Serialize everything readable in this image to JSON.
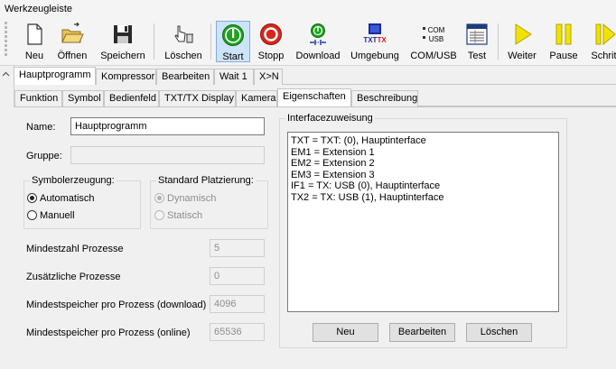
{
  "window": {
    "title": "Werkzeugleiste"
  },
  "toolbar": {
    "buttons": [
      {
        "label": "Neu",
        "icon": "new-document-icon"
      },
      {
        "label": "Öffnen",
        "icon": "open-folder-icon"
      },
      {
        "label": "Speichern",
        "icon": "floppy-disk-icon"
      },
      {
        "label": "Löschen",
        "icon": "delete-pointer-icon"
      },
      {
        "label": "Start",
        "icon": "start-icon"
      },
      {
        "label": "Stopp",
        "icon": "stop-icon"
      },
      {
        "label": "Download",
        "icon": "download-icon"
      },
      {
        "label": "Umgebung",
        "icon": "environment-icon",
        "icon_text": "TXTTX"
      },
      {
        "label": "COM/USB",
        "icon": "com-usb-icon",
        "icon_text": [
          "COM",
          "USB"
        ]
      },
      {
        "label": "Test",
        "icon": "test-window-icon"
      },
      {
        "label": "Weiter",
        "icon": "play-icon"
      },
      {
        "label": "Pause",
        "icon": "pause-icon"
      },
      {
        "label": "Schritt",
        "icon": "step-icon"
      }
    ],
    "active": "Start"
  },
  "program_tabs": [
    "Hauptprogramm",
    "Kompressor",
    "Bearbeiten",
    "Wait 1",
    "X>N"
  ],
  "program_tabs_selected": "Hauptprogramm",
  "sub_tabs": [
    "Funktion",
    "Symbol",
    "Bedienfeld",
    "TXT/TX Display",
    "Kamera",
    "Eigenschaften",
    "Beschreibung"
  ],
  "sub_tabs_selected": "Eigenschaften",
  "properties": {
    "name_label": "Name:",
    "name_value": "Hauptprogramm",
    "gruppe_label": "Gruppe:",
    "gruppe_value": "",
    "symbol_group": {
      "title": "Symbolerzeugung:",
      "options": [
        "Automatisch",
        "Manuell"
      ],
      "selected": "Automatisch"
    },
    "placement_group": {
      "title": "Standard Platzierung:",
      "options": [
        "Dynamisch",
        "Statisch"
      ],
      "selected": "Dynamisch",
      "disabled": true
    },
    "fields": [
      {
        "label": "Mindestzahl Prozesse",
        "value": "5"
      },
      {
        "label": "Zusätzliche Prozesse",
        "value": "0"
      },
      {
        "label": "Mindestspeicher pro Prozess (download)",
        "value": "4096"
      },
      {
        "label": "Mindestspeicher pro Prozess (online)",
        "value": "65536"
      }
    ]
  },
  "interface": {
    "title": "Interfacezuweisung",
    "entries": [
      "TXT = TXT: (0), Hauptinterface",
      "EM1 = Extension 1",
      "EM2 = Extension 2",
      "EM3 = Extension 3",
      "IF1 = TX: USB (0), Hauptinterface",
      "TX2 = TX: USB (1), Hauptinterface"
    ],
    "buttons": {
      "new": "Neu",
      "edit": "Bearbeiten",
      "delete": "Löschen"
    }
  },
  "colors": {
    "start_green": "#1fa31f",
    "stop_red": "#d9261c",
    "play_yellow": "#f2e200",
    "active_blue": "#cce4f7"
  }
}
